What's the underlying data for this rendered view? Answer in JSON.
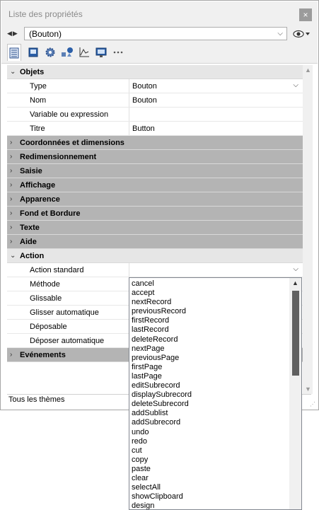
{
  "window": {
    "title": "Liste des propriétés",
    "close_glyph": "×"
  },
  "selector": {
    "nav_arrows": "◀▶",
    "value": "(Bouton)"
  },
  "toolbar": {
    "icons": [
      "list-icon",
      "book-icon",
      "gear-icon",
      "shapes-icon",
      "chart-icon",
      "monitor-icon",
      "more-icon"
    ]
  },
  "sections": {
    "objets": "Objets",
    "coords": "Coordonnées et dimensions",
    "resize": "Redimensionnement",
    "saisie": "Saisie",
    "affichage": "Affichage",
    "apparence": "Apparence",
    "fond": "Fond et Bordure",
    "texte": "Texte",
    "aide": "Aide",
    "action": "Action",
    "evenements": "Evénements"
  },
  "props": {
    "type": {
      "name": "Type",
      "value": "Bouton"
    },
    "nom": {
      "name": "Nom",
      "value": "Bouton"
    },
    "variable": {
      "name": "Variable ou expression",
      "value": ""
    },
    "titre": {
      "name": "Titre",
      "value": "Button"
    },
    "action_std": {
      "name": "Action standard",
      "value": ""
    },
    "methode": {
      "name": "Méthode"
    },
    "glissable": {
      "name": "Glissable"
    },
    "glisser_auto": {
      "name": "Glisser automatique"
    },
    "deposable": {
      "name": "Déposable"
    },
    "deposer_auto": {
      "name": "Déposer automatique"
    }
  },
  "footer": {
    "label": "Tous les thèmes"
  },
  "dropdown": {
    "options": [
      "cancel",
      "accept",
      "nextRecord",
      "previousRecord",
      "firstRecord",
      "lastRecord",
      "deleteRecord",
      "nextPage",
      "previousPage",
      "firstPage",
      "lastPage",
      "editSubrecord",
      "displaySubrecord",
      "deleteSubrecord",
      "addSublist",
      "addSubrecord",
      "undo",
      "redo",
      "cut",
      "copy",
      "paste",
      "clear",
      "selectAll",
      "showClipboard",
      "design"
    ]
  },
  "colors": {
    "section_bg": "#b4b4b4",
    "chrome_bg": "#f0f0f0",
    "scroll_thumb": "#606060"
  }
}
